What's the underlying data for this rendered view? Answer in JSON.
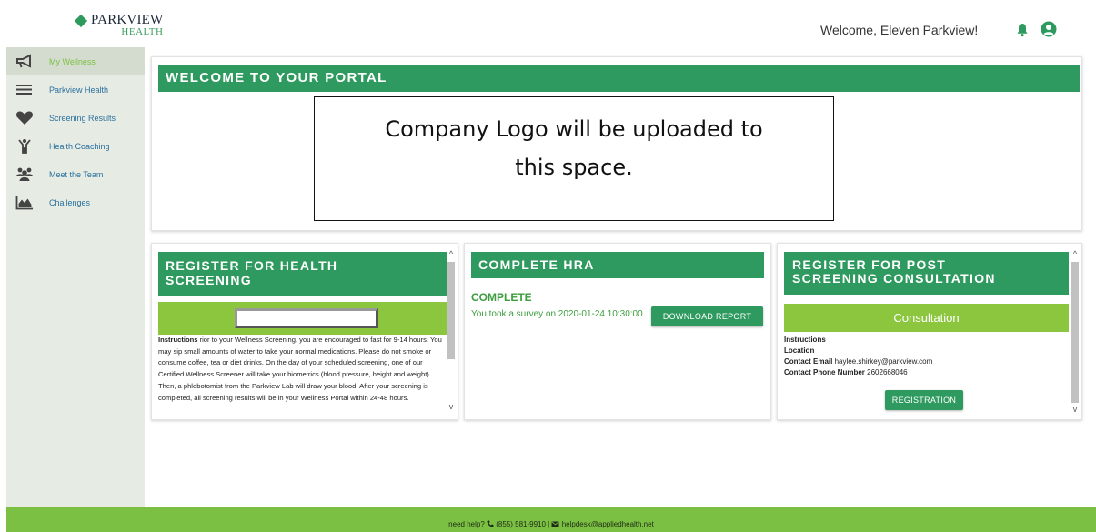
{
  "header": {
    "logo_name": "PARKVIEW",
    "logo_sub": "HEALTH",
    "welcome": "Welcome, Eleven Parkview!"
  },
  "icons": {
    "bell": "bell-icon",
    "user": "user-circle-icon"
  },
  "sidebar": {
    "items": [
      {
        "label": "My Wellness",
        "icon": "megaphone-icon",
        "active": true
      },
      {
        "label": "Parkview Health",
        "icon": "menu-lines-icon",
        "active": false
      },
      {
        "label": "Screening Results",
        "icon": "heart-icon",
        "active": false
      },
      {
        "label": "Health Coaching",
        "icon": "person-cheer-icon",
        "active": false
      },
      {
        "label": "Meet the Team",
        "icon": "group-icon",
        "active": false
      },
      {
        "label": "Challenges",
        "icon": "area-chart-icon",
        "active": false
      }
    ]
  },
  "welcome_card": {
    "title": "WELCOME TO YOUR PORTAL",
    "logo_placeholder_line1": "Company Logo will be uploaded to",
    "logo_placeholder_line2": "this space."
  },
  "screening_card": {
    "title_line1": "REGISTER FOR HEALTH",
    "title_line2": "SCREENING",
    "instructions_label": "Instructions",
    "instructions_text": " rior to your Wellness Screening, you are encouraged to fast for 9-14 hours. You may sip small amounts of water to take your normal medications. Please do not smoke or consume coffee, tea or diet drinks. On the day of your scheduled screening, one of our Certified Wellness Screener will take your biometrics (blood pressure, height and weight). Then, a phlebotomist from the Parkview Lab will draw your blood. After your screening is completed, all screening results will be in your Wellness Portal within 24-48 hours."
  },
  "hra_card": {
    "title": "COMPLETE HRA",
    "status": "COMPLETE",
    "survey_text": "You took a survey on 2020-01-24 10:30:00",
    "button": "DOWNLOAD REPORT"
  },
  "post_card": {
    "title_line1": "REGISTER FOR POST",
    "title_line2": "SCREENING CONSULTATION",
    "consultation": "Consultation",
    "instructions_label": "Instructions",
    "location_label": "Location",
    "email_label": "Contact Email",
    "email_value": "haylee.shirkey@parkview.com",
    "phone_label": "Contact Phone Number",
    "phone_value": "2602668046",
    "button": "REGISTRATION"
  },
  "footer": {
    "help_text": "need help?",
    "phone": "(855) 581-9910 |",
    "email": "helpdesk@appliedhealth.net"
  },
  "colors": {
    "banner_green": "#2f9a5f",
    "light_green": "#8cc63f",
    "footer_green": "#7cc043",
    "sidebar_bg": "#e6ece3"
  }
}
